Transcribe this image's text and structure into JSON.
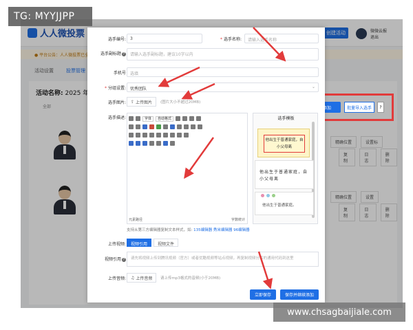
{
  "watermarks": {
    "tg": "TG: MYYJJPP",
    "site": "www.chsagbaijiale.com"
  },
  "background": {
    "logo_text": "人人微投票",
    "create_button": "创建活动",
    "user_name": "微微云报",
    "user_sub": "退出",
    "notice": "● 平台公告：人人微投票已全面升级，欢迎使用",
    "tabs": [
      "活动设置",
      "投票管理"
    ],
    "activity_label": "活动名称:",
    "activity_value": "2025 年度",
    "sub_label": "全部",
    "add_button": "添加",
    "import_button": "批量导入选手",
    "help_button": "?",
    "row_actions_1": [
      "精确位置",
      "设置标"
    ],
    "row_actions_2": [
      "复制",
      "日志",
      "删除"
    ],
    "row_actions_3": [
      "精确位置",
      "设置"
    ],
    "row_actions_4": [
      "复制",
      "日志",
      "删除"
    ]
  },
  "modal": {
    "fields": {
      "number_label": "选手编号:",
      "number_value": "3",
      "name_label": "选手名称:",
      "name_placeholder": "请输入选手名称",
      "subtitle_label": "选手副标题",
      "subtitle_placeholder": "请输入选手副标题，建议10字以内",
      "phone_label": "手机号",
      "phone_placeholder": "选填",
      "group_label": "分组设置:",
      "group_value": "优秀团队",
      "image_label": "选手图片:",
      "upload_image_button": "上传图片",
      "image_hint": "(图片大小不超过20MB)",
      "desc_label": "选手描述:",
      "video_label": "上传视频:",
      "video_tab_link": "视频引用",
      "video_tab_file": "视频文件",
      "video_ref_label": "视频引用",
      "video_ref_placeholder": "请先将视频上传到腾讯视频（官方）或者优酷视频等站点视频，再复制视频分享的通用代码到这里",
      "audio_label": "上传音频:",
      "upload_audio_button": "上传音频",
      "audio_hint": "请上传mp3格式的音频(小于20MB)"
    },
    "editor": {
      "font_select": "字体",
      "size_select": "自动格式",
      "footer_left": "元素路径",
      "footer_right": "字数统计"
    },
    "template": {
      "title": "选手模板",
      "card1_text": "他出生于普通家庭，自小父母离",
      "card2_text": "他出生于普通家庭，自小父母离",
      "card3_text": "他出生于普通家庭。"
    },
    "support": {
      "prefix": "支持从第三方编辑器复制文本样式，如:",
      "links": [
        "135编辑器",
        "秀米编辑器",
        "96编辑器"
      ]
    },
    "buttons": {
      "save": "立即保存",
      "save_continue": "保存并继续添加"
    }
  }
}
